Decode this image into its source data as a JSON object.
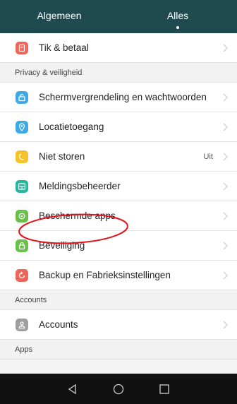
{
  "tabs": {
    "general": "Algemeen",
    "all": "Alles"
  },
  "rows": {
    "pay": {
      "label": "Tik & betaal",
      "icon": "card-icon",
      "color": "#f0655a"
    },
    "lock": {
      "label": "Schermvergrendeling en wachtwoorden",
      "icon": "lock-screen-icon",
      "color": "#3fa9e8"
    },
    "location": {
      "label": "Locatietoegang",
      "icon": "location-icon",
      "color": "#3fa9e8"
    },
    "dnd": {
      "label": "Niet storen",
      "value": "Uit",
      "icon": "moon-icon",
      "color": "#f7c229"
    },
    "notifications": {
      "label": "Meldingsbeheerder",
      "icon": "notification-manager-icon",
      "color": "#27b79d"
    },
    "protected": {
      "label": "Beschermde apps",
      "icon": "protected-apps-icon",
      "color": "#6bc04b"
    },
    "security": {
      "label": "Beveiliging",
      "icon": "shield-lock-icon",
      "color": "#6bc04b"
    },
    "backup": {
      "label": "Backup en Fabrieksinstellingen",
      "icon": "backup-icon",
      "color": "#f0655a"
    },
    "accounts": {
      "label": "Accounts",
      "icon": "person-icon",
      "color": "#9e9e9e"
    }
  },
  "sections": {
    "privacy": "Privacy & veiligheid",
    "accounts": "Accounts",
    "apps": "Apps"
  },
  "annotation": {
    "color": "#e0141b"
  },
  "navbar": {
    "buttons": [
      "back-icon",
      "home-icon",
      "recents-icon"
    ]
  }
}
